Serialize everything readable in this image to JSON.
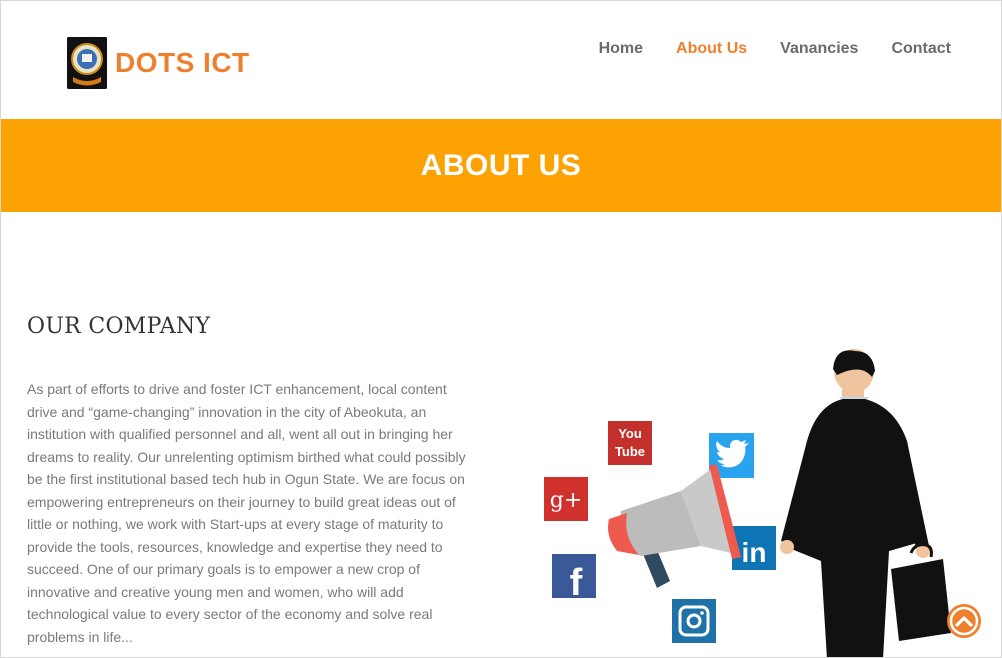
{
  "brand": {
    "name": "DOTS ICT",
    "logo_icon": "institution-seal-icon"
  },
  "nav": {
    "items": [
      {
        "label": "Home",
        "active": false
      },
      {
        "label": "About Us",
        "active": true
      },
      {
        "label": "Vanancies",
        "active": false
      },
      {
        "label": "Contact",
        "active": false
      }
    ]
  },
  "banner": {
    "title": "ABOUT US",
    "background_color": "#fca203"
  },
  "company": {
    "heading": "OUR COMPANY",
    "body": "As part of efforts to drive and foster ICT enhancement, local content drive and “game-changing” innovation in the city of Abeokuta, an institution with qualified personnel and all, went all out in bringing her dreams to reality. Our unrelenting optimism birthed what could possibly be the first institutional based tech hub in Ogun State. We are focus on empowering entrepreneurs on their journey to build great ideas out of little or nothing, we work with Start-ups at every stage of maturity to provide the tools, resources, knowledge and expertise they need to succeed. One of our primary goals is to empower a new crop of innovative and creative young men and women, who will add technological value to every sector of the economy and solve real problems in life..."
  },
  "illustration": {
    "icons": [
      "youtube-icon",
      "twitter-icon",
      "google-plus-icon",
      "linkedin-icon",
      "facebook-icon",
      "instagram-icon",
      "megaphone-icon",
      "businessman-icon"
    ],
    "youtube_text": [
      "You",
      "Tube"
    ],
    "google_text": "g+",
    "linkedin_text": "in",
    "facebook_text": "f"
  },
  "colors": {
    "accent": "#ee7f2d",
    "banner": "#fca203",
    "nav_text": "#6b6b6b",
    "body_text": "#7a7a7a"
  },
  "scroll_top": {
    "icon": "chevron-up-icon"
  }
}
